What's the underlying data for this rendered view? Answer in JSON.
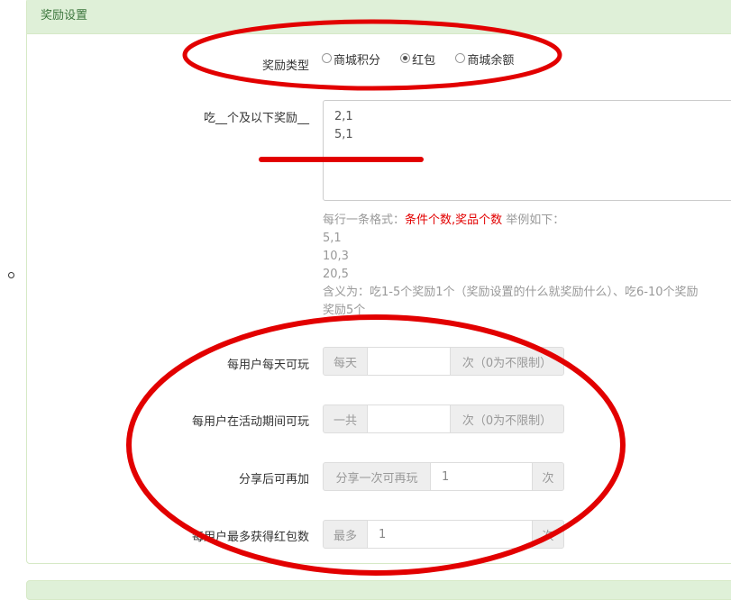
{
  "panel": {
    "title": "奖励设置"
  },
  "reward_type": {
    "label": "奖励类型",
    "options": [
      {
        "label": "商城积分",
        "checked": false
      },
      {
        "label": "红包",
        "checked": true
      },
      {
        "label": "商城余额",
        "checked": false
      }
    ]
  },
  "eat_reward": {
    "label": "吃__个及以下奖励__",
    "value": "2,1\n5,1"
  },
  "help": {
    "prefix": "每行一条格式：",
    "format": "条件个数,奖品个数",
    "suffix": " 举例如下：",
    "examples": [
      "5,1",
      "10,3",
      "20,5"
    ],
    "meaning_line1": "含义为：吃1-5个奖励1个（奖励设置的什么就奖励什么）、吃6-10个奖励",
    "meaning_line2": "奖励5个"
  },
  "daily": {
    "label": "每用户每天可玩",
    "prefix": "每天",
    "value": "",
    "suffix": "次（0为不限制）"
  },
  "total": {
    "label": "每用户在活动期间可玩",
    "prefix": "一共",
    "value": "",
    "suffix": "次（0为不限制）"
  },
  "share": {
    "label": "分享后可再加",
    "prefix": "分享一次可再玩",
    "value": "1",
    "suffix": "次"
  },
  "max_redpack": {
    "label": "每用户最多获得红包数",
    "prefix": "最多",
    "value": "1",
    "suffix": "次"
  },
  "colors": {
    "annotation_red": "#e20000",
    "panel_header_bg": "#dff0d8",
    "panel_header_text": "#3c763d"
  }
}
